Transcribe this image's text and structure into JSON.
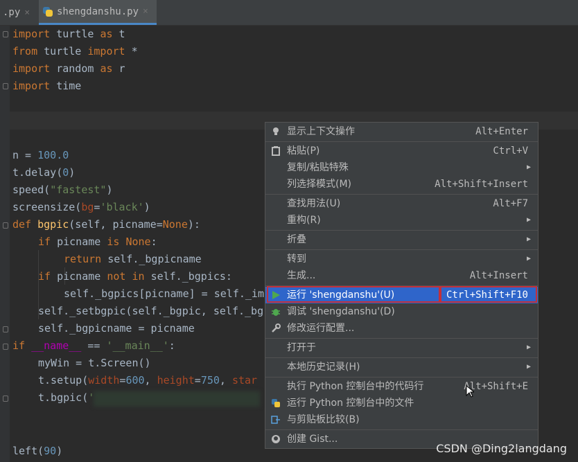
{
  "tabs": [
    {
      "label": ".py",
      "close": "×"
    },
    {
      "label": "shengdanshu.py",
      "close": "×",
      "icon": "python-file-icon"
    }
  ],
  "code": {
    "import_turtle": {
      "kw": "import",
      "mod": " turtle ",
      "as": "as",
      "alias": " t"
    },
    "from_import": {
      "kw1": "from",
      "mod": " turtle ",
      "kw2": "import",
      "rest": " *"
    },
    "import_random": {
      "kw": "import",
      "mod": " random ",
      "as": "as",
      "alias": " r"
    },
    "import_time": {
      "kw": "import",
      "mod": " time"
    },
    "n_assign": {
      "pre": "n = ",
      "num": "100.0"
    },
    "delay": {
      "pre": "t.delay(",
      "num": "0",
      "post": ")"
    },
    "speed": {
      "pre": "speed(",
      "str": "\"fastest\"",
      "post": ")"
    },
    "screensize": {
      "pre": "screensize(",
      "prm": "bg",
      "eq": "=",
      "str": "'black'",
      "post": ")"
    },
    "def_line": {
      "kw": "def ",
      "fn": "bgpic",
      "pre": "(self, picname=",
      "kw2": "None",
      "post": "):"
    },
    "if1": {
      "kw": "if ",
      "mid": "picname ",
      "kw2": "is ",
      "kw3": "None",
      "post": ":"
    },
    "ret": {
      "kw": "return ",
      "rest": "self._bgpicname"
    },
    "if2": {
      "kw": "if ",
      "mid": "picname ",
      "kw2": "not in ",
      "rest": "self._bgpics:"
    },
    "assign_pics": {
      "text": "self._bgpics[picname] = self._im"
    },
    "setbgpic": {
      "text": "self._setbgpic(self._bgpic, self._bg"
    },
    "bgpicname": {
      "text": "self._bgpicname = picname"
    },
    "if_main": {
      "kw": "if ",
      "d1": "__name__",
      "eq": " == ",
      "str": "'__main__'",
      "post": ":"
    },
    "mywin": {
      "text": "myWin = t.Screen()"
    },
    "setup": {
      "pre": "t.setup(",
      "p1": "width",
      "e1": "=",
      "n1": "600",
      "c": ", ",
      "p2": "height",
      "e2": "=",
      "n2": "750",
      "c2": ", ",
      "p3": "star"
    },
    "bgpic_call": {
      "pre": "t.bgpic(",
      "str": "'"
    },
    "left": {
      "pre": "left(",
      "num": "90",
      "post": ")"
    }
  },
  "menu": {
    "items": [
      {
        "label": "显示上下文操作",
        "shortcut": "Alt+Enter",
        "icon": "lightbulb-icon"
      },
      {
        "label": "粘贴(P)",
        "shortcut": "Ctrl+V",
        "icon": "clipboard-icon"
      },
      {
        "label": "复制/粘贴特殊",
        "shortcut": "",
        "arrow": "▶"
      },
      {
        "label": "列选择模式(M)",
        "shortcut": "Alt+Shift+Insert"
      },
      {
        "label": "查找用法(U)",
        "shortcut": "Alt+F7"
      },
      {
        "label": "重构(R)",
        "arrow": "▶"
      },
      {
        "label": "折叠",
        "arrow": "▶"
      },
      {
        "label": "转到",
        "arrow": "▶"
      },
      {
        "label": "生成...",
        "shortcut": "Alt+Insert"
      },
      {
        "label": "运行 'shengdanshu'(U)",
        "shortcut": "Ctrl+Shift+F10",
        "icon": "run-icon",
        "selected": true
      },
      {
        "label": "调试 'shengdanshu'(D)",
        "icon": "debug-icon"
      },
      {
        "label": "修改运行配置...",
        "icon": "wrench-icon"
      },
      {
        "label": "打开于",
        "arrow": "▶"
      },
      {
        "label": "本地历史记录(H)",
        "arrow": "▶"
      },
      {
        "label": "执行 Python 控制台中的代码行",
        "shortcut": "Alt+Shift+E"
      },
      {
        "label": "运行 Python 控制台中的文件",
        "icon": "python-icon"
      },
      {
        "label": "与剪贴板比较(B)",
        "icon": "compare-icon"
      },
      {
        "label": "创建 Gist...",
        "icon": "github-icon"
      }
    ]
  },
  "watermark": "CSDN @Ding2langdang",
  "colors": {
    "selection": "#2f65ca",
    "highlight_border": "#c2303a",
    "keyword": "#cc7832",
    "string": "#6a8759",
    "number": "#6897bb"
  }
}
